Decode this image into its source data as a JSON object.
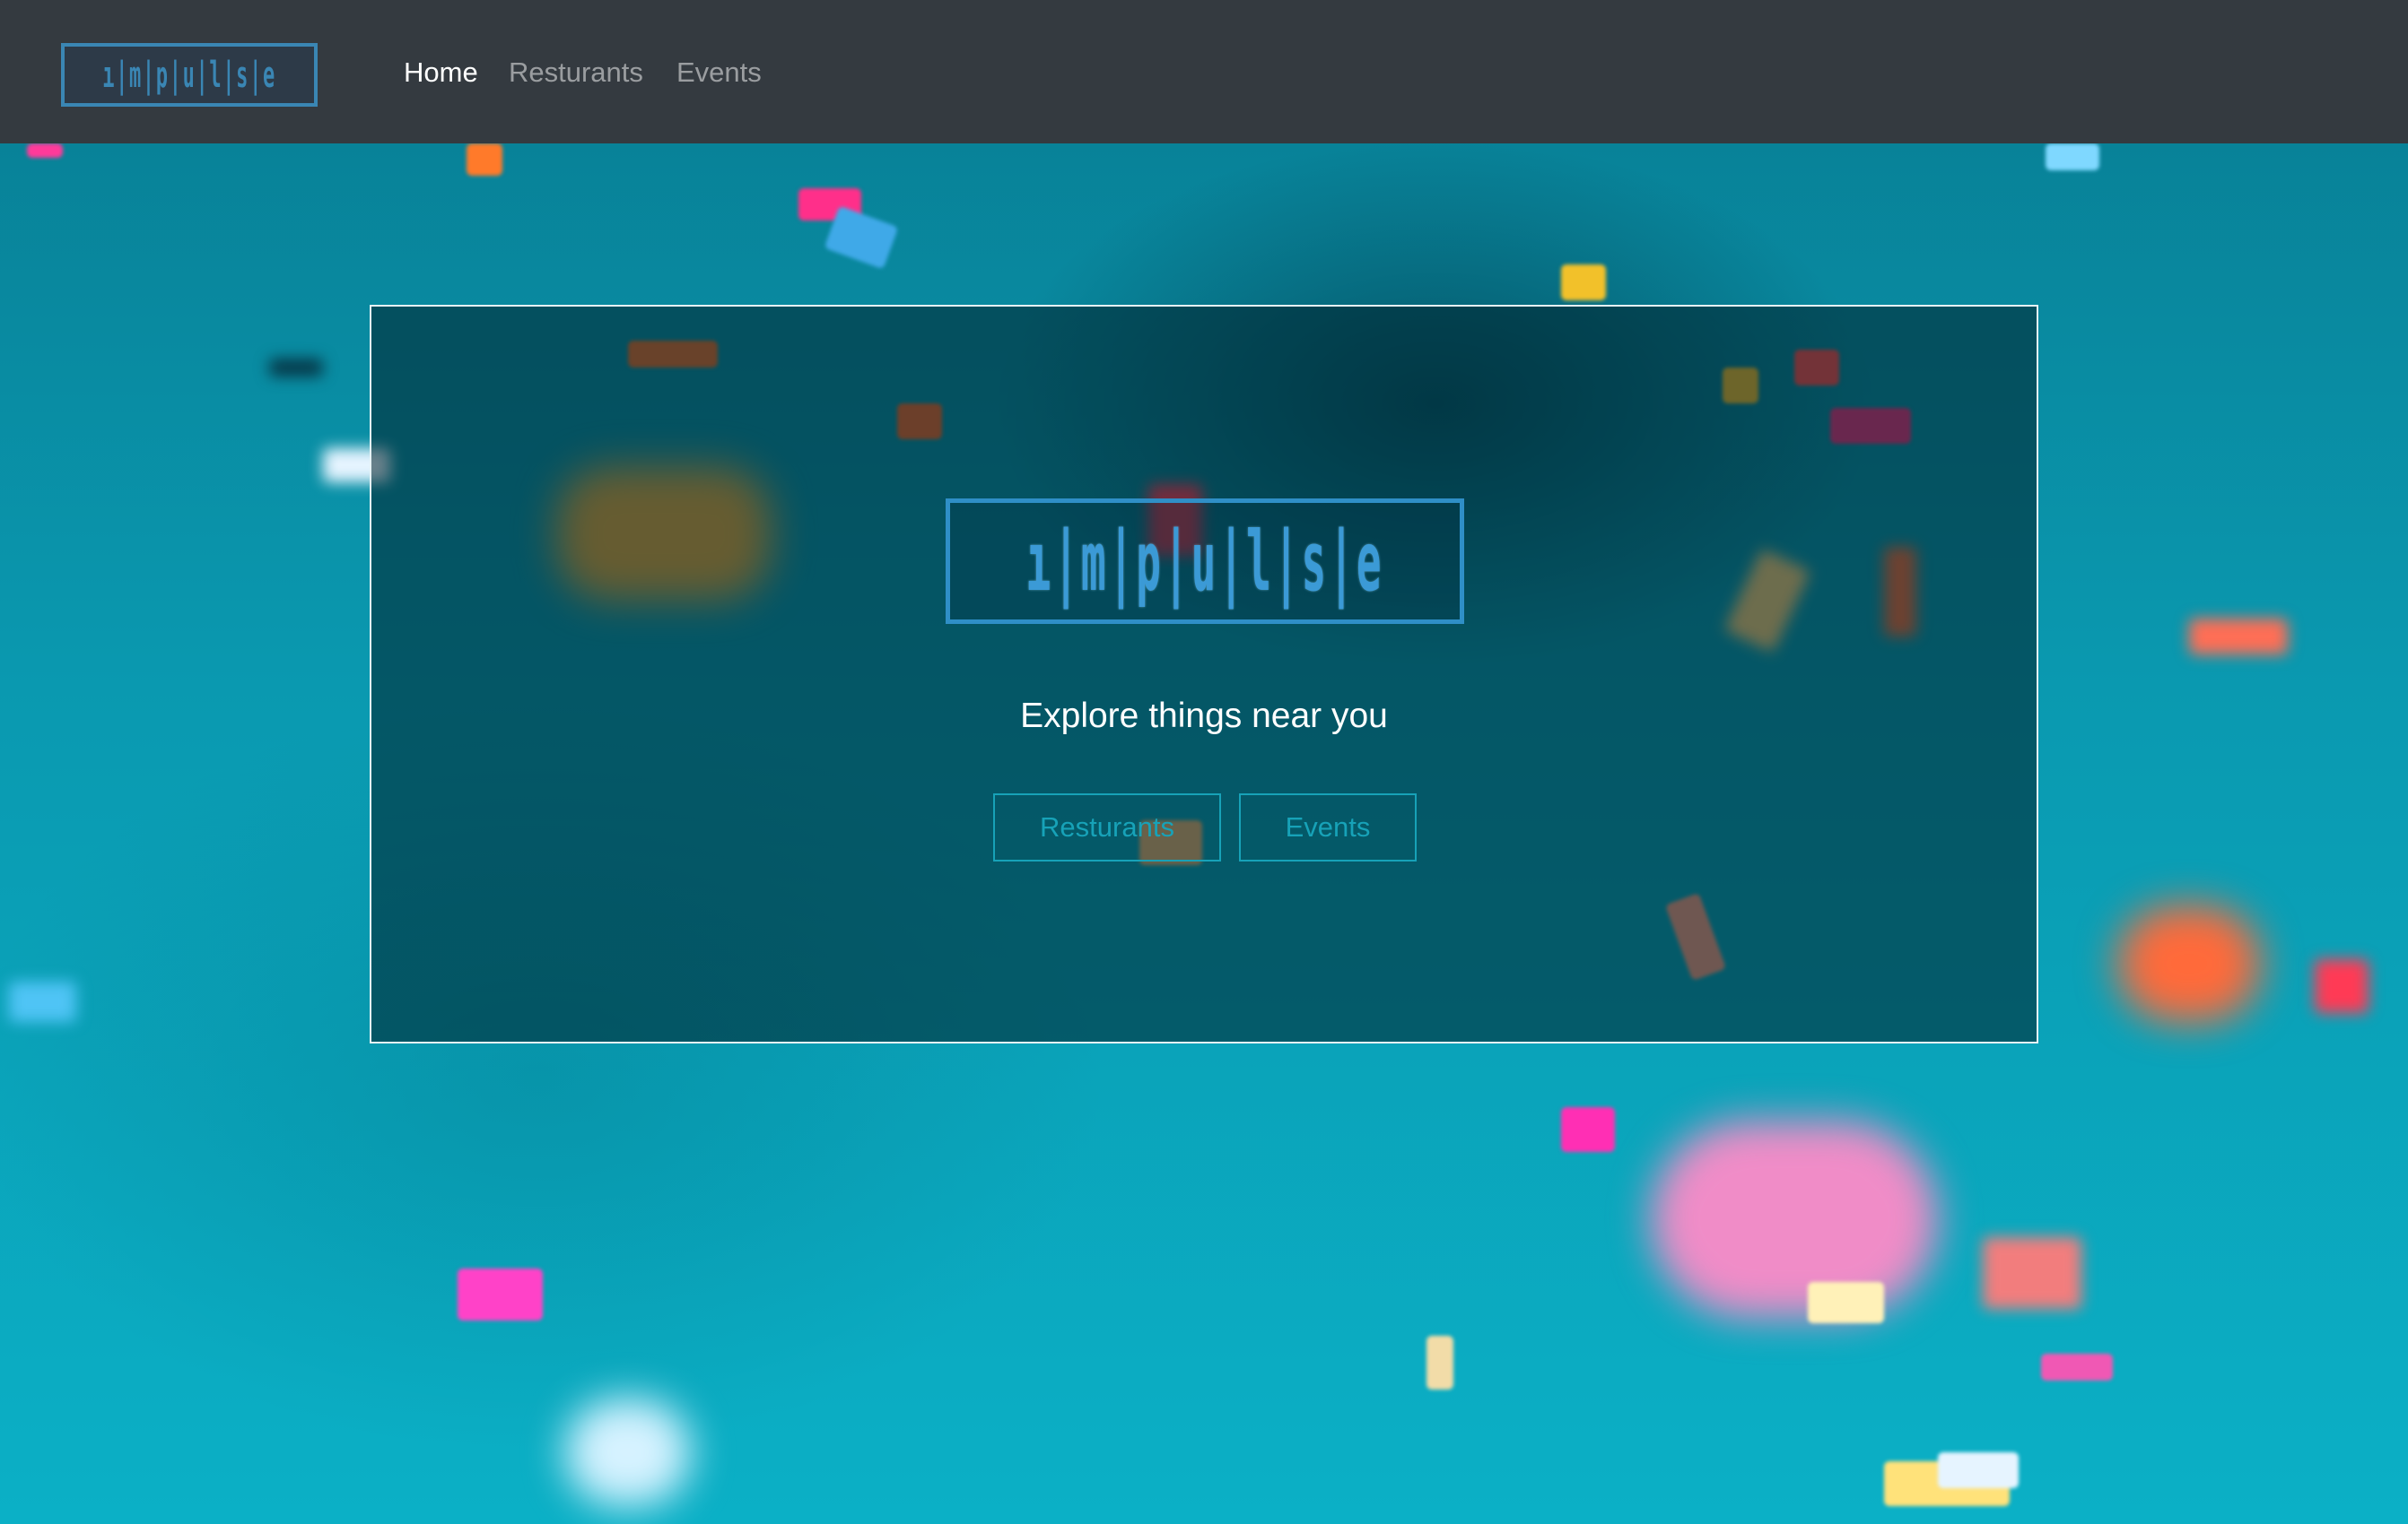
{
  "navbar": {
    "brand": {
      "logo_text": "ı|m|p|u|l|s|e",
      "icon": "impulse-logo"
    },
    "links": [
      {
        "label": "Home",
        "active": true
      },
      {
        "label": "Resturants",
        "active": false
      },
      {
        "label": "Events",
        "active": false
      }
    ],
    "background_color": "#343a40"
  },
  "hero": {
    "logo_text": "ı|m|p|u|l|s|e",
    "tagline": "Explore things near you",
    "buttons": [
      {
        "label": "Resturants"
      },
      {
        "label": "Events"
      }
    ],
    "accent_color": "#17a2b8"
  },
  "background": {
    "description_icon": "confetti-background",
    "primary_color": "#0aa7bd"
  }
}
